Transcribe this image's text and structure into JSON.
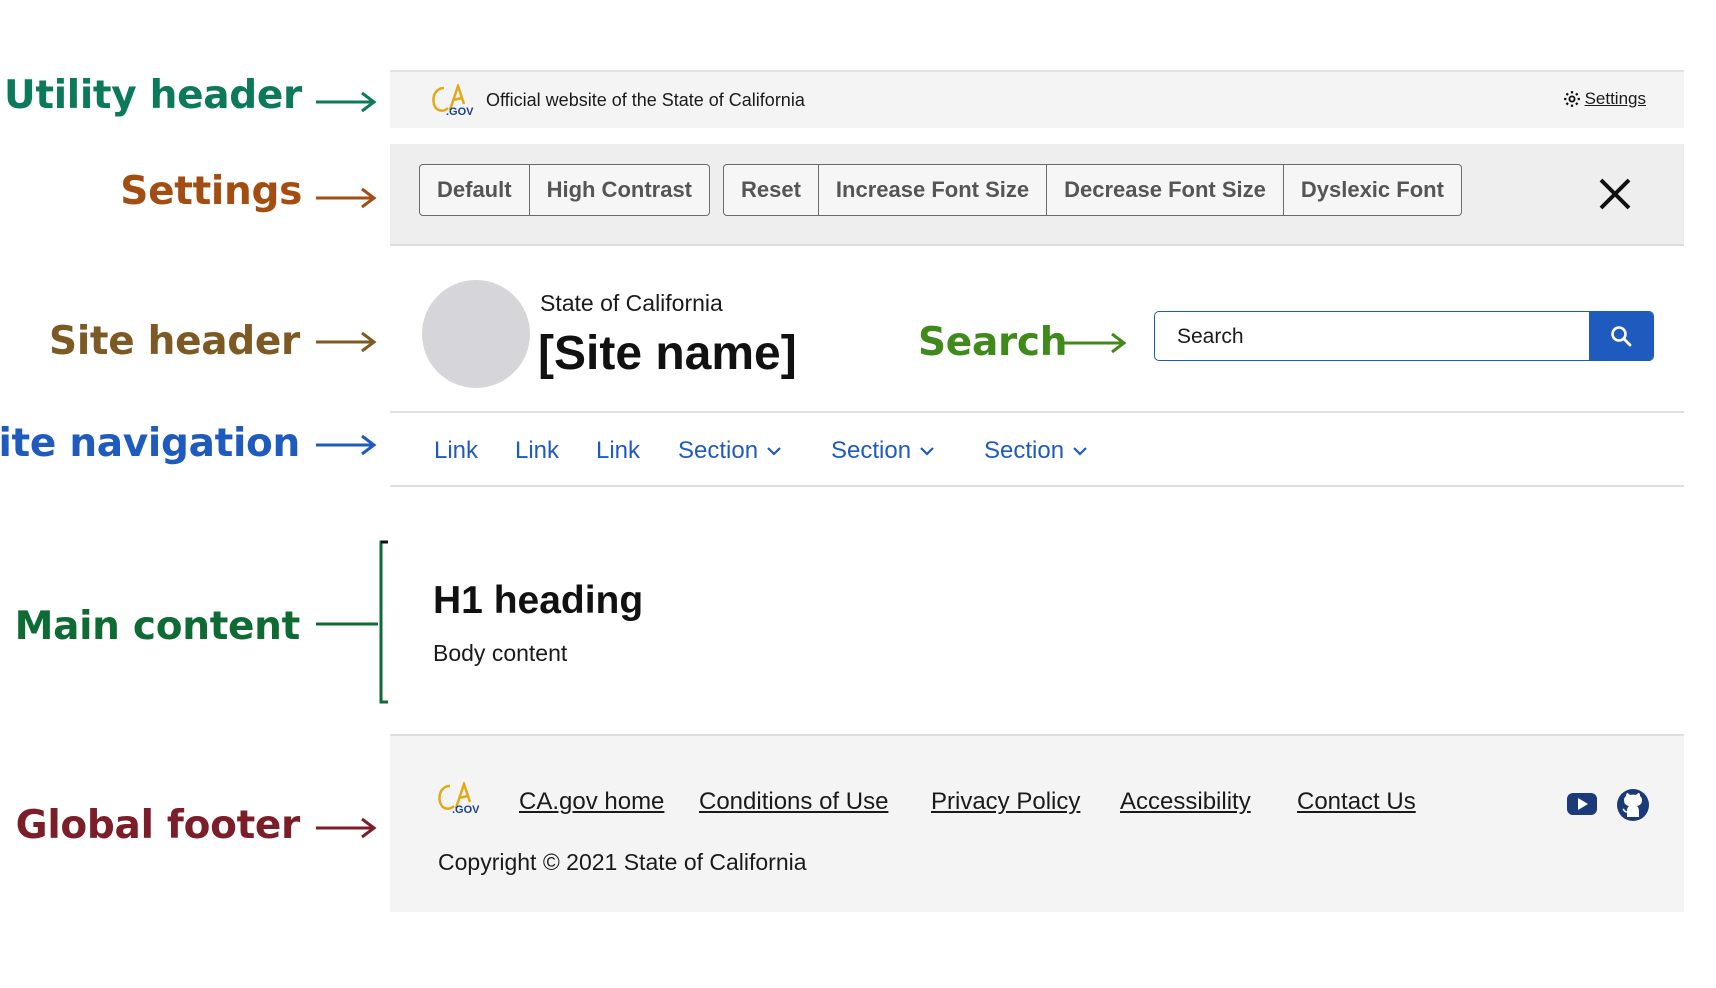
{
  "annotations": {
    "utility_header": "Utility header",
    "settings": "Settings",
    "site_header": "Site header",
    "site_navigation": "Site navigation",
    "main_content": "Main content",
    "search": "Search",
    "global_footer": "Global footer"
  },
  "colors": {
    "utility_header": "#0c7a5a",
    "settings": "#a34d12",
    "site_header": "#7d5a23",
    "site_navigation": "#1f5bbf",
    "main_content": "#0f6b34",
    "search": "#3f8a1a",
    "global_footer": "#7b1e2a",
    "link_blue": "#1f5bbf"
  },
  "utility_header": {
    "logo_text": ".GOV",
    "official_text": "Official website of the State of California",
    "settings_label": "Settings",
    "settings_icon": "gear-icon"
  },
  "settings_bar": {
    "group1": [
      "Default",
      "High Contrast"
    ],
    "group2": [
      "Reset",
      "Increase Font Size",
      "Decrease Font Size",
      "Dyslexic Font"
    ],
    "close_icon": "close-icon"
  },
  "site_header": {
    "state": "State of California",
    "site_name": "[Site name]",
    "search_placeholder": "Search",
    "search_icon": "search-icon"
  },
  "site_nav": {
    "items": [
      {
        "label": "Link",
        "dropdown": false
      },
      {
        "label": "Link",
        "dropdown": false
      },
      {
        "label": "Link",
        "dropdown": false
      },
      {
        "label": "Section",
        "dropdown": true
      },
      {
        "label": "Section",
        "dropdown": true
      },
      {
        "label": "Section",
        "dropdown": true
      }
    ]
  },
  "main": {
    "heading": "H1 heading",
    "body": "Body content"
  },
  "footer": {
    "logo_text": ".GOV",
    "links": [
      "CA.gov home",
      "Conditions of Use",
      "Privacy Policy",
      "Accessibility",
      "Contact Us"
    ],
    "copyright": "Copyright © 2021 State of California",
    "social_icons": [
      "youtube-icon",
      "github-icon"
    ]
  }
}
